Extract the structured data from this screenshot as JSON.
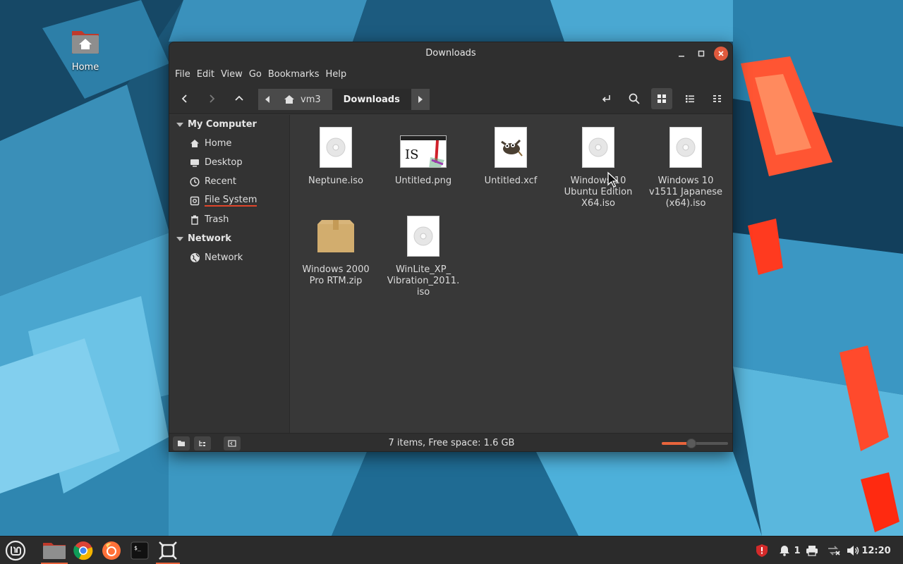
{
  "desktop": {
    "home_icon_label": "Home"
  },
  "window": {
    "title": "Downloads",
    "menu": [
      "File",
      "Edit",
      "View",
      "Go",
      "Bookmarks",
      "Help"
    ],
    "breadcrumb": {
      "root": "vm3",
      "current": "Downloads"
    }
  },
  "sidebar": {
    "sections": [
      {
        "title": "My Computer",
        "items": [
          {
            "label": "Home",
            "icon": "home-icon"
          },
          {
            "label": "Desktop",
            "icon": "desktop-icon"
          },
          {
            "label": "Recent",
            "icon": "recent-icon"
          },
          {
            "label": "File System",
            "icon": "drive-icon"
          },
          {
            "label": "Trash",
            "icon": "trash-icon"
          }
        ]
      },
      {
        "title": "Network",
        "items": [
          {
            "label": "Network",
            "icon": "network-icon"
          }
        ]
      }
    ]
  },
  "files": [
    {
      "name": "Neptune.iso",
      "type": "iso"
    },
    {
      "name": "Untitled.png",
      "type": "png-thumbnail"
    },
    {
      "name": "Untitled.xcf",
      "type": "xcf"
    },
    {
      "name": "Windows 10 Ubuntu Edition X64.iso",
      "type": "iso"
    },
    {
      "name": "Windows 10 v1511 Japanese (x64).iso",
      "type": "iso"
    },
    {
      "name": "Windows 2000 Pro RTM.zip",
      "type": "zip"
    },
    {
      "name": "WinLite_XP_ Vibration_2011. iso",
      "type": "iso"
    }
  ],
  "png_thumbnail_text": "IS",
  "statusbar": {
    "text": "7 items, Free space: 1.6 GB",
    "zoom_level": 0.45
  },
  "taskbar": {
    "notification_count": "1",
    "clock": "12:20"
  },
  "colors": {
    "accent": "#e8643c",
    "close": "#e05a3d",
    "window_bg": "#383838"
  }
}
